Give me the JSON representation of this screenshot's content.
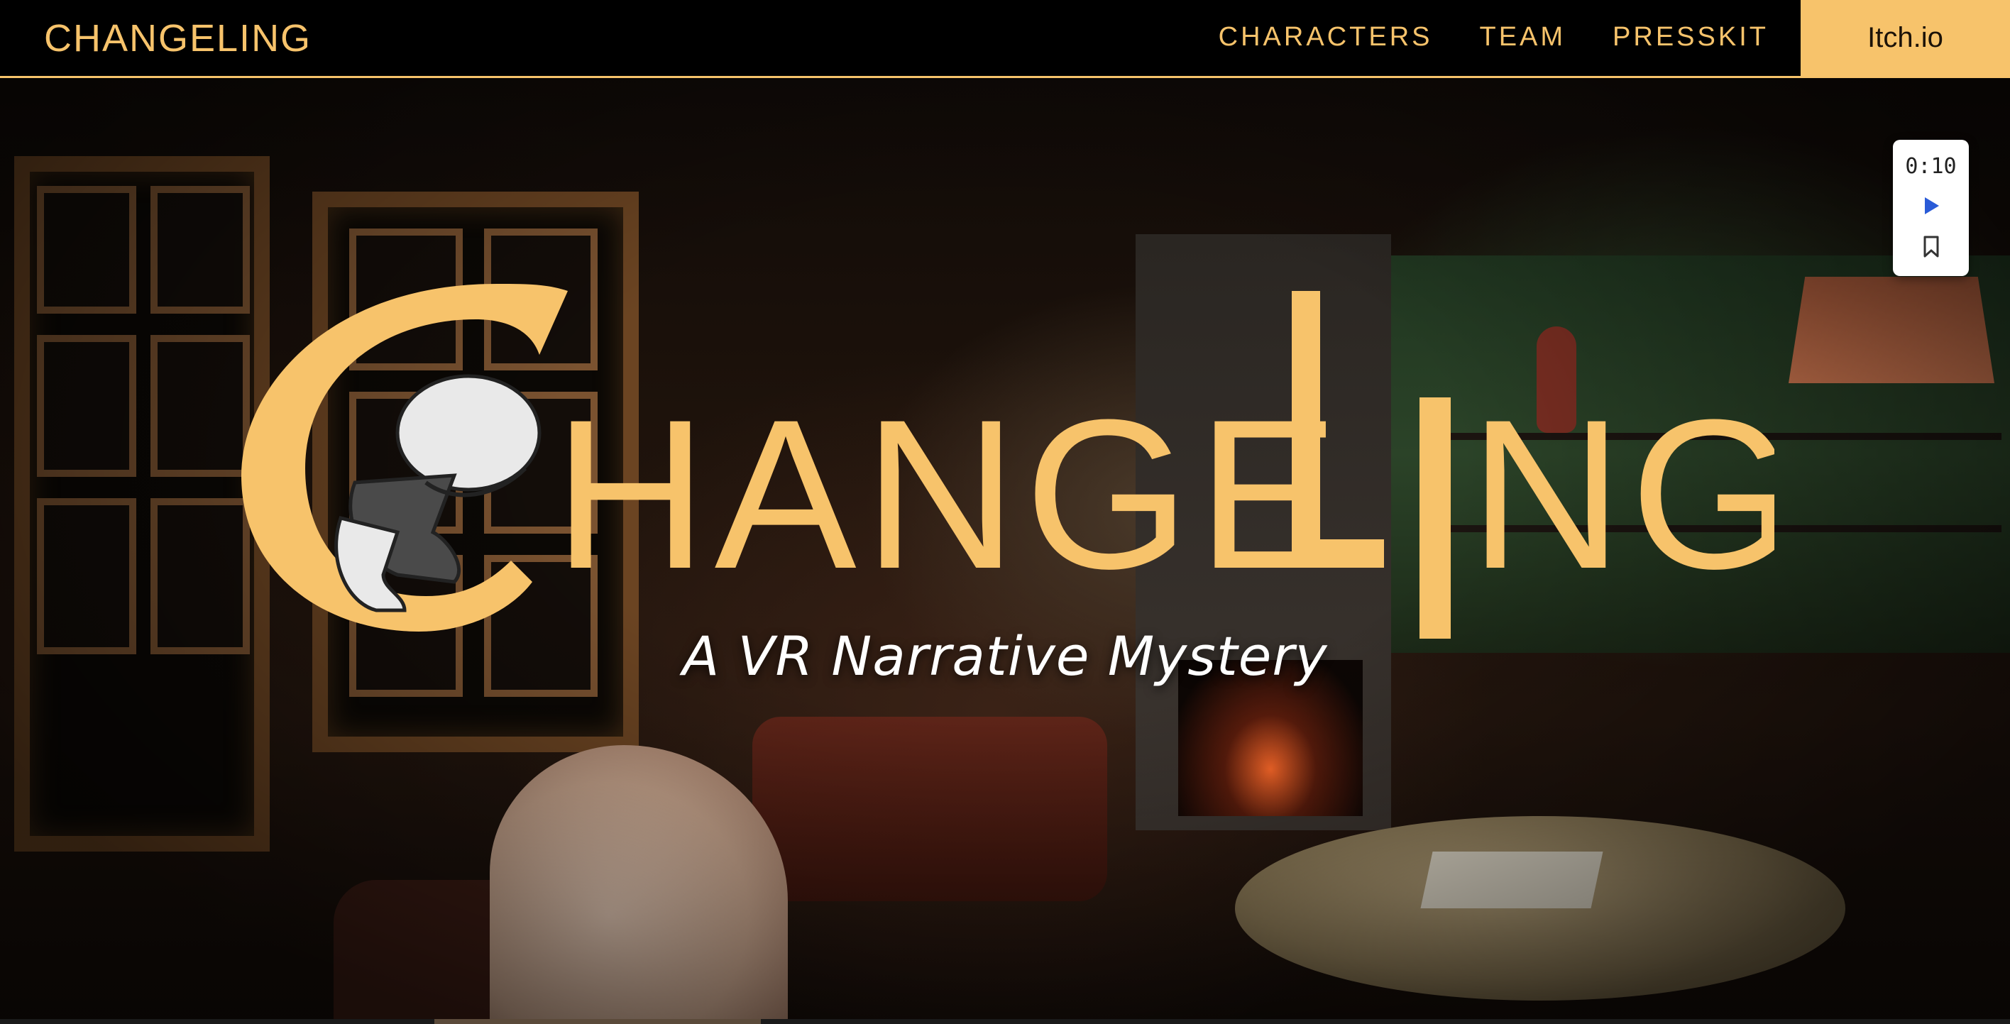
{
  "nav": {
    "logo_text": "CHANGELING",
    "links": [
      "CHARACTERS",
      "TEAM",
      "PRESSKIT"
    ],
    "cta": "Itch.io"
  },
  "hero": {
    "title": "CHANGELING",
    "tagline": "A VR Narrative Mystery"
  },
  "video": {
    "time": "0:10",
    "play_icon": "play-icon",
    "bookmark_icon": "bookmark-icon"
  },
  "colors": {
    "accent": "#f7c36b",
    "nav_bg": "#000000",
    "cta_text": "#1b1208",
    "play_blue": "#2a5bd7"
  }
}
